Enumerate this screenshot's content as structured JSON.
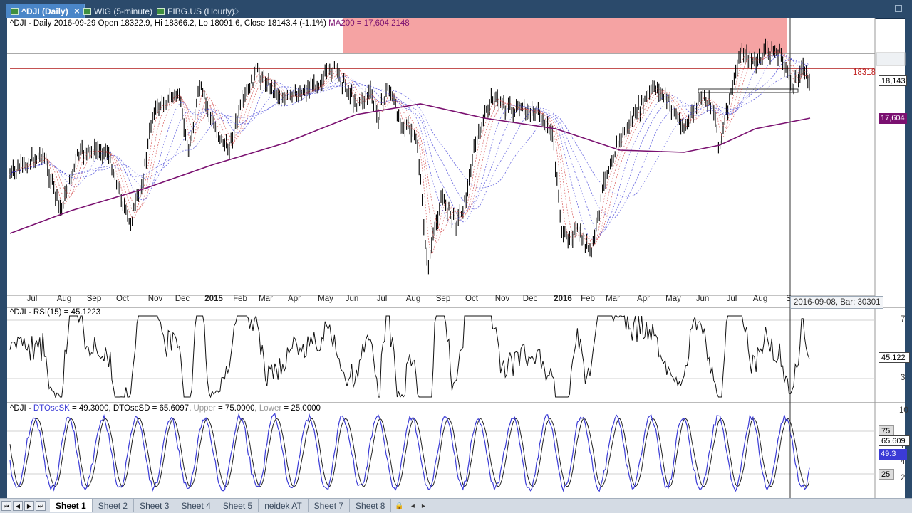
{
  "tabs": [
    {
      "label": "^DJI (Daily)",
      "active": true,
      "icon": "chart-icon"
    },
    {
      "label": "WIG (5-minute)",
      "active": false,
      "icon": "chart-icon"
    },
    {
      "label": "FIBG.US (Hourly)",
      "active": false,
      "icon": "chart-icon"
    }
  ],
  "main_pane": {
    "header": "^DJI - Daily 2016-09-29 Open 18322.9, Hi 18366.2, Lo 18091.6, Close 18143.4 (-1.1%)",
    "ma_label": "MA200 = 17,604.2148",
    "price_line_label": "18318",
    "last_price_tag": "18,143",
    "ma_price_tag": "17,604"
  },
  "time_axis": [
    "Jul",
    "Aug",
    "Sep",
    "Oct",
    "Nov",
    "Dec",
    "2015",
    "Feb",
    "Mar",
    "Apr",
    "May",
    "Jun",
    "Jul",
    "Aug",
    "Sep",
    "Oct",
    "Nov",
    "Dec",
    "2016",
    "Feb",
    "Mar",
    "Apr",
    "May",
    "Jun",
    "Jul",
    "Aug",
    "S"
  ],
  "cursor_tooltip": "2016-09-08, Bar: 30301",
  "rsi_pane": {
    "header": "^DJI - RSI(15) = 45.1223",
    "value_tag": "45.122",
    "scale": [
      "7",
      "3"
    ]
  },
  "stoch_pane": {
    "header_prefix": "^DJI - ",
    "sk_label": "DTOscSK",
    "header_mid": " = 49.3000, DTOscSD = 65.6097, ",
    "upper_label": "Upper",
    "upper_value": " = 75.0000, ",
    "lower_label": "Lower",
    "lower_value": " = 25.0000",
    "tag_75": "75",
    "tag_sd": "65.609",
    "tag_sk": "49.3",
    "tag_25": "25",
    "scale": [
      "10",
      "7",
      "4",
      "2"
    ]
  },
  "sheets": [
    "Sheet 1",
    "Sheet 2",
    "Sheet 3",
    "Sheet 4",
    "Sheet 5",
    "neidek AT",
    "Sheet 7",
    "Sheet 8"
  ],
  "colors": {
    "tab_bg": "#2b4a6b",
    "tab_active": "#4a86c8",
    "ma200": "#7a1070",
    "price_line": "#b01818",
    "resistance_zone": "#f5a3a3",
    "stoch_sk": "#3b3bd6"
  }
}
